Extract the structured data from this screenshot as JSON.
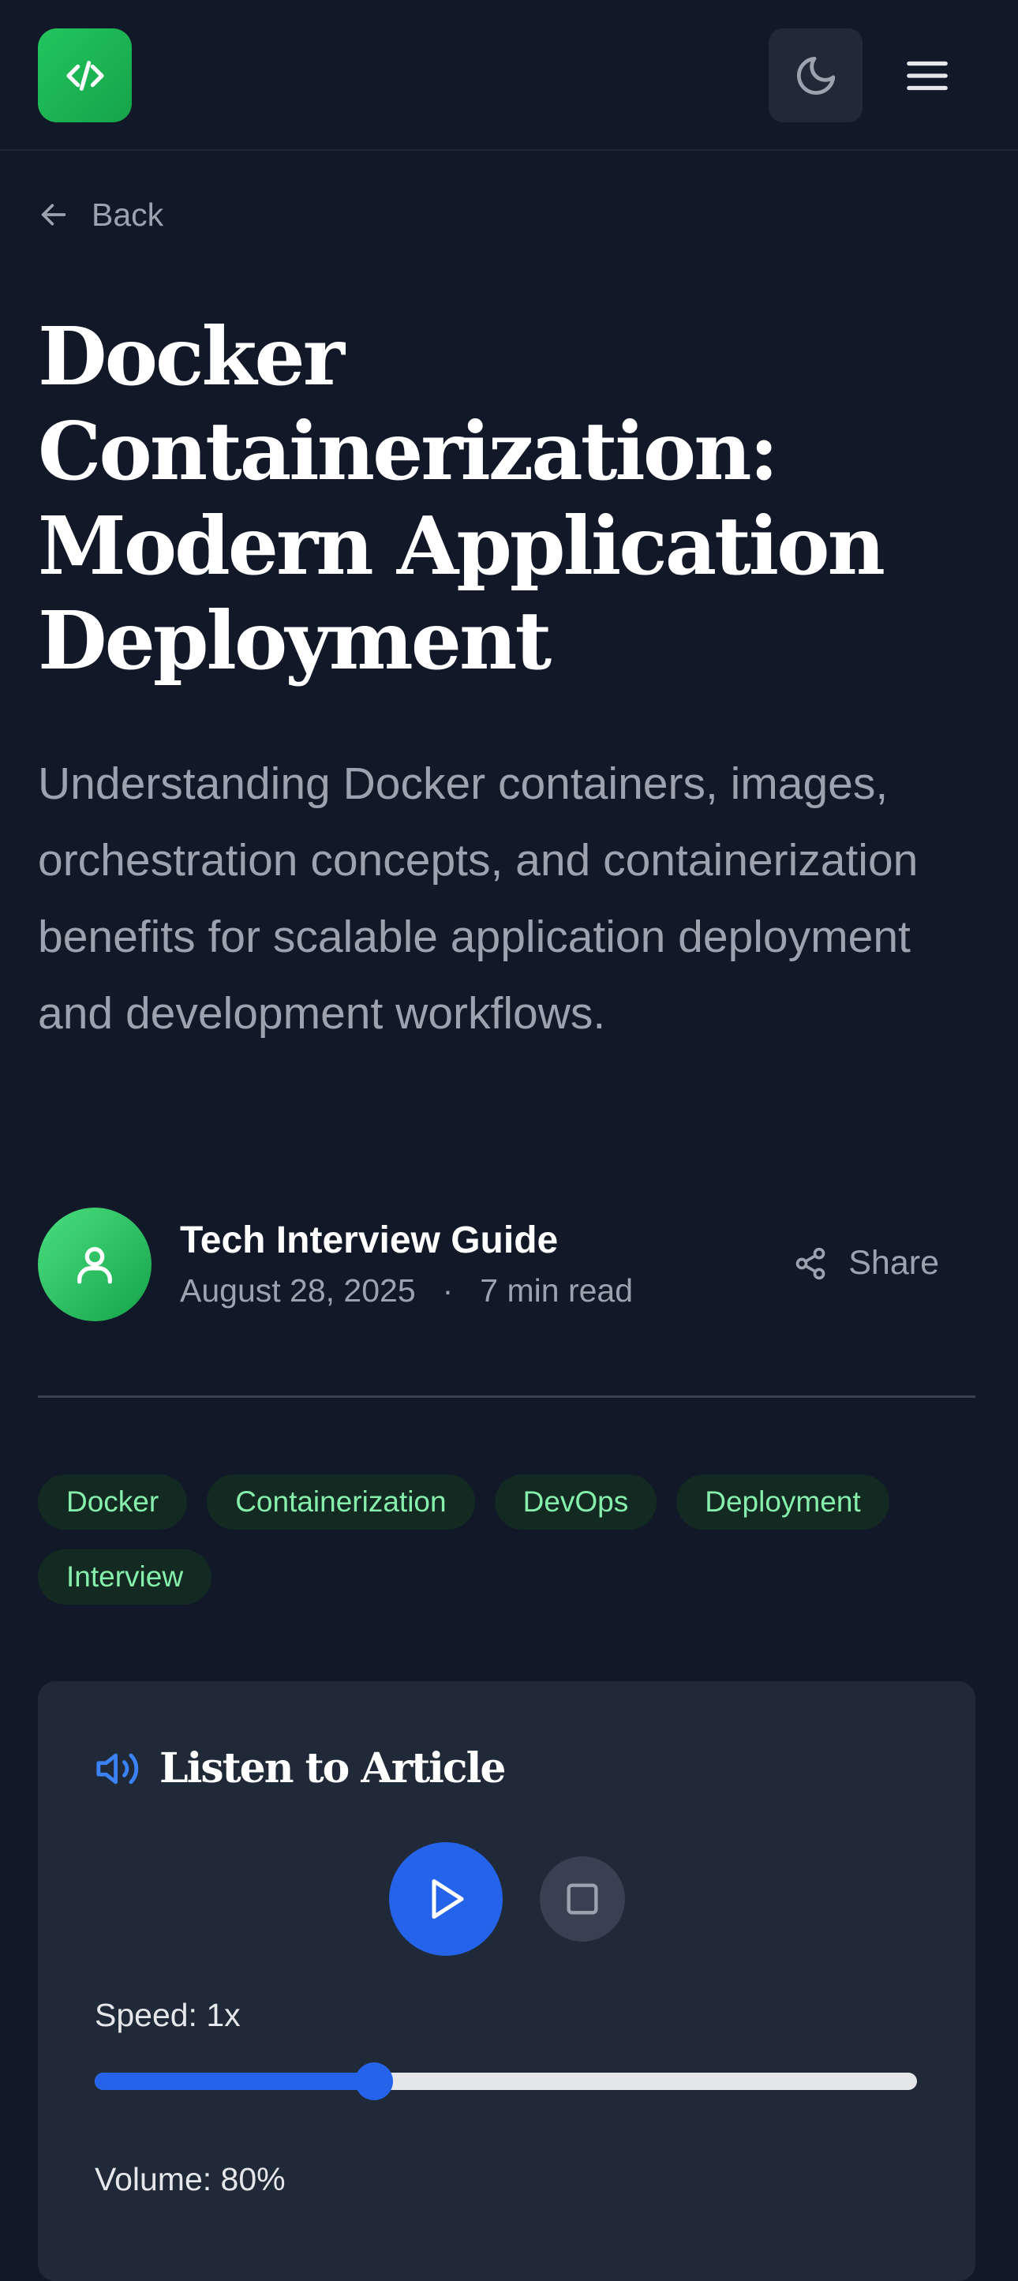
{
  "header": {
    "logo_icon": "code-icon",
    "theme_icon": "moon-icon",
    "menu_icon": "hamburger-menu-icon"
  },
  "back": {
    "label": "Back",
    "icon": "arrow-left-icon"
  },
  "article": {
    "title": "Docker Containerization: Modern Application Deployment",
    "subtitle": "Understanding Docker containers, images, orchestration concepts, and containerization benefits for scalable application deployment and development workflows.",
    "author": "Tech Interview Guide",
    "date": "August 28, 2025",
    "separator": "·",
    "read_time": "7 min read",
    "share_label": "Share",
    "tags": [
      "Docker",
      "Containerization",
      "DevOps",
      "Deployment",
      "Interview"
    ]
  },
  "audio": {
    "title": "Listen to Article",
    "speed_label": "Speed: 1x",
    "speed_level": 0.34,
    "volume_label": "Volume: 80%"
  },
  "colors": {
    "background": "#111827",
    "card": "#1f2937",
    "accent_green": "#22c55e",
    "accent_blue": "#2563eb",
    "tag_text": "#86efac"
  }
}
